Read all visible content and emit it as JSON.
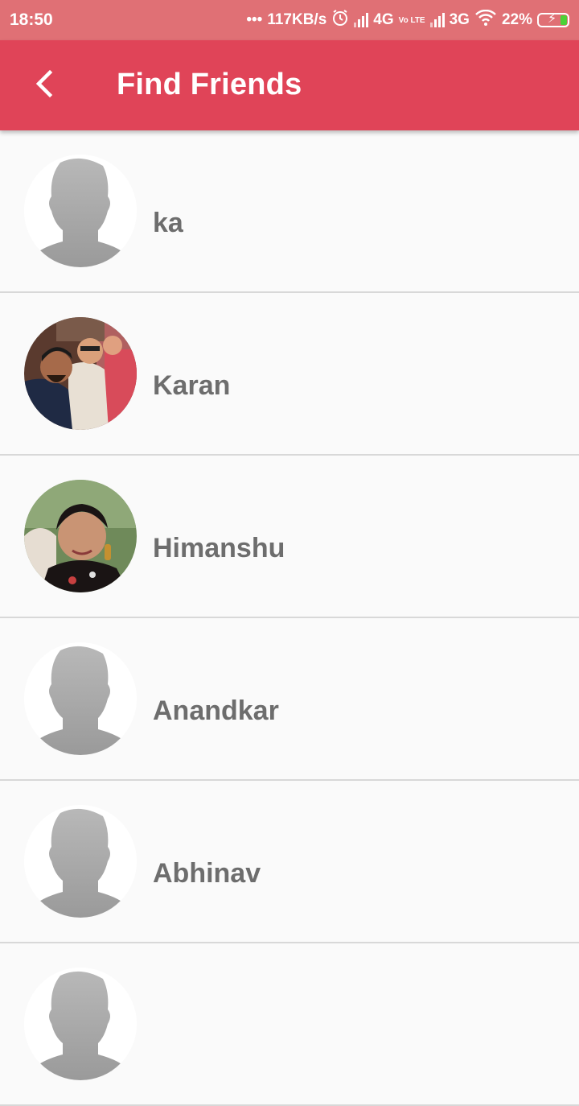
{
  "status_bar": {
    "time": "18:50",
    "dots": "•••",
    "speed": "117KB/s",
    "net1": "4G",
    "volte": "Vo LTE",
    "net2": "3G",
    "battery": "22%"
  },
  "app_bar": {
    "title": "Find Friends"
  },
  "friends": [
    {
      "name": "ka",
      "avatar": "default"
    },
    {
      "name": "Karan",
      "avatar": "photo-group"
    },
    {
      "name": "Himanshu",
      "avatar": "photo-woman"
    },
    {
      "name": "Anandkar",
      "avatar": "default"
    },
    {
      "name": "Abhinav",
      "avatar": "default"
    },
    {
      "name": "",
      "avatar": "default"
    }
  ],
  "colors": {
    "status_bar": "#e07075",
    "app_bar": "#e04458",
    "name_text": "#6d6d6d",
    "divider": "#d8d8d8"
  }
}
